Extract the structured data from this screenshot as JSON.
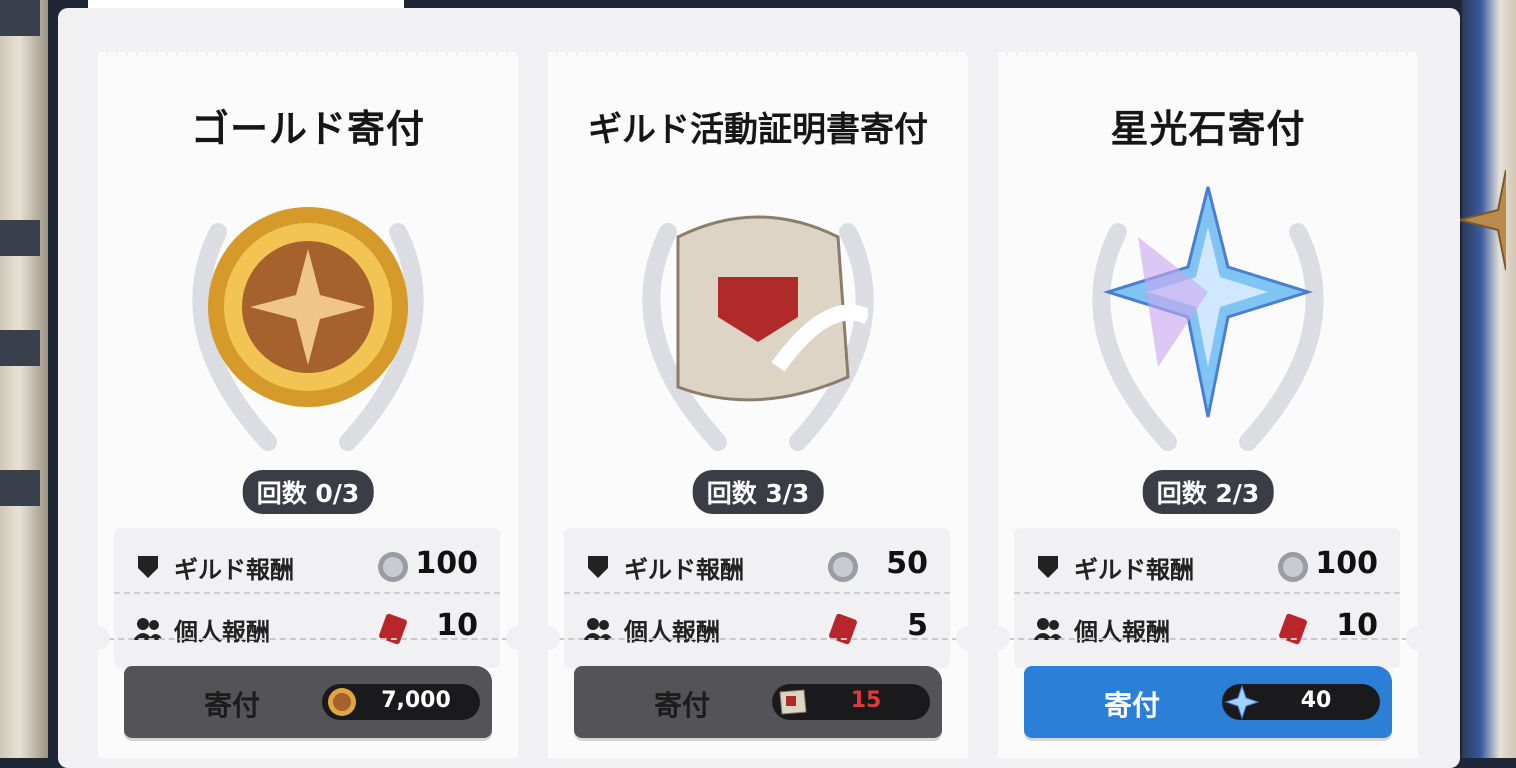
{
  "cards": [
    {
      "title": "ゴールド寄付",
      "count": "回数 0/3",
      "guild_reward_label": "ギルド報酬",
      "guild_reward_value": "100",
      "personal_reward_label": "個人報酬",
      "personal_reward_value": "10",
      "donate_label": "寄付",
      "cost_icon": "gold-coin-icon",
      "cost_value": "7,000",
      "enabled": false
    },
    {
      "title": "ギルド活動証明書寄付",
      "count": "回数 3/3",
      "guild_reward_label": "ギルド報酬",
      "guild_reward_value": "50",
      "personal_reward_label": "個人報酬",
      "personal_reward_value": "5",
      "donate_label": "寄付",
      "cost_icon": "certificate-icon",
      "cost_value": "15",
      "cost_color": "#e23a3a",
      "enabled": false
    },
    {
      "title": "星光石寄付",
      "count": "回数 2/3",
      "guild_reward_label": "ギルド報酬",
      "guild_reward_value": "100",
      "personal_reward_label": "個人報酬",
      "personal_reward_value": "10",
      "donate_label": "寄付",
      "cost_icon": "starlight-stone-icon",
      "cost_value": "40",
      "enabled": true,
      "accent": "#2b7fd6"
    }
  ]
}
